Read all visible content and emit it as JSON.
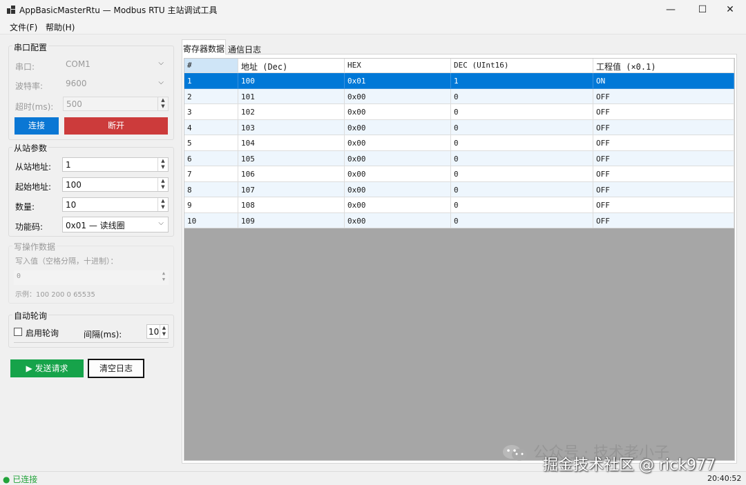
{
  "window": {
    "title": "AppBasicMasterRtu — Modbus RTU 主站调试工具",
    "minimize": "—",
    "maximize": "☐",
    "close": "✕"
  },
  "menu": [
    "文件(F)",
    "帮助(H)"
  ],
  "serial": {
    "title": "串口配置",
    "port_label": "串口:",
    "port_value": "COM1",
    "baud_label": "波特率:",
    "baud_value": "9600",
    "timeout_label": "超时(ms):",
    "timeout_value": "500",
    "connect": "连接",
    "disconnect": "断开"
  },
  "slave": {
    "title": "从站参数",
    "addr_label": "从站地址:",
    "addr_value": "1",
    "start_label": "起始地址:",
    "start_value": "100",
    "count_label": "数量:",
    "count_value": "10",
    "func_label": "功能码:",
    "func_value": "0x01 — 读线圈"
  },
  "write": {
    "title": "写操作数据",
    "hint": "写入值（空格分隔，十进制）：",
    "value": "0",
    "example": "示例：100 200 0 65535"
  },
  "poll": {
    "title": "自动轮询",
    "enable_label": "启用轮询",
    "interval_label": "间隔(ms):",
    "interval_value": "10"
  },
  "actions": {
    "send": "▶ 发送请求",
    "clear": "清空日志"
  },
  "tabs": [
    "寄存器数据",
    "通信日志"
  ],
  "table": {
    "columns": [
      "#",
      "地址 (Dec)",
      "HEX",
      "DEC (UInt16)",
      "工程值 (×0.1)"
    ],
    "rows": [
      [
        "1",
        "100",
        "0x01",
        "1",
        "ON"
      ],
      [
        "2",
        "101",
        "0x00",
        "0",
        "OFF"
      ],
      [
        "3",
        "102",
        "0x00",
        "0",
        "OFF"
      ],
      [
        "4",
        "103",
        "0x00",
        "0",
        "OFF"
      ],
      [
        "5",
        "104",
        "0x00",
        "0",
        "OFF"
      ],
      [
        "6",
        "105",
        "0x00",
        "0",
        "OFF"
      ],
      [
        "7",
        "106",
        "0x00",
        "0",
        "OFF"
      ],
      [
        "8",
        "107",
        "0x00",
        "0",
        "OFF"
      ],
      [
        "9",
        "108",
        "0x00",
        "0",
        "OFF"
      ],
      [
        "10",
        "109",
        "0x00",
        "0",
        "OFF"
      ]
    ],
    "selected_row": 0
  },
  "status": {
    "state": "● 已连接",
    "time": "20:40:52"
  },
  "watermark": {
    "line1": "公众号 · 技术老小子",
    "line2": "掘金技术社区 @ rick977"
  },
  "colors": {
    "connect": "#0a77d4",
    "disconnect": "#cc3b3b",
    "send": "#16a34a",
    "selected": "#0078d7",
    "alt_row": "#eef6fd",
    "status_ok": "#22a33a"
  }
}
